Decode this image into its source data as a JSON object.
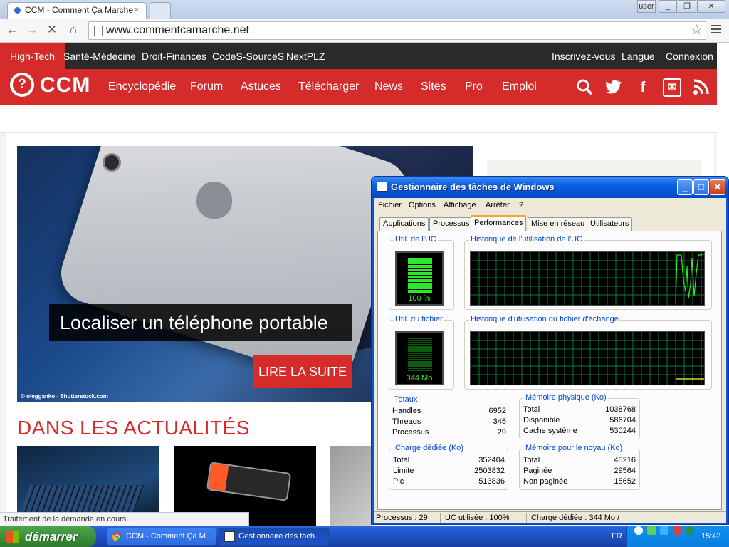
{
  "browser": {
    "tab_title": "CCM - Comment Ça Marche",
    "tab_close": "×",
    "url": "www.commentcamarche.net",
    "window_controls": [
      "user",
      "_",
      "❐",
      "✕"
    ]
  },
  "site": {
    "top_nav": [
      "High-Tech",
      "Santé-Médecine",
      "Droit-Finances",
      "CodeS-SourceS",
      "NextPLZ"
    ],
    "top_right": [
      "Inscrivez-vous",
      "Langue",
      "Connexion"
    ],
    "logo_mark": "?",
    "logo_text": "CCM",
    "main_nav": [
      "Encyclopédie",
      "Forum",
      "Astuces",
      "Télécharger",
      "News",
      "Sites",
      "Pro",
      "Emploi"
    ],
    "hero_title": "Localiser un téléphone portable",
    "hero_cta": "LIRE LA SUITE",
    "hero_credit": "© olegganko - Shutterstock.com",
    "section_title": "DANS LES ACTUALITÉS",
    "status_text": "Traitement de la demande en cours...",
    "colors": {
      "brand_red": "#d52b2b",
      "top_bar": "#2a2a2a"
    }
  },
  "taskmgr": {
    "title": "Gestionnaire des tâches de Windows",
    "menu": [
      "Fichier",
      "Options",
      "Affichage",
      "Arrêter",
      "?"
    ],
    "tabs": [
      "Applications",
      "Processus",
      "Performances",
      "Mise en réseau",
      "Utilisateurs"
    ],
    "active_tab": "Performances",
    "cpu_label": "Util. de l'UC",
    "cpu_value": "100 %",
    "cpu_history_label": "Historique de l'utilisation de l'UC",
    "pf_label": "Util. du fichier",
    "pf_value": "344 Mo",
    "pf_history_label": "Historique d'utilisation du fichier d'échange",
    "totals": {
      "title": "Totaux",
      "rows": [
        {
          "label": "Handles",
          "value": "6952"
        },
        {
          "label": "Threads",
          "value": "345"
        },
        {
          "label": "Processus",
          "value": "29"
        }
      ]
    },
    "physical": {
      "title": "Mémoire physique (Ko)",
      "rows": [
        {
          "label": "Total",
          "value": "1038768"
        },
        {
          "label": "Disponible",
          "value": "586704"
        },
        {
          "label": "Cache système",
          "value": "530244"
        }
      ]
    },
    "commit": {
      "title": "Charge dédiée (Ko)",
      "rows": [
        {
          "label": "Total",
          "value": "352404"
        },
        {
          "label": "Limite",
          "value": "2503832"
        },
        {
          "label": "Pic",
          "value": "513836"
        }
      ]
    },
    "kernel": {
      "title": "Mémoire pour le noyau (Ko)",
      "rows": [
        {
          "label": "Total",
          "value": "45216"
        },
        {
          "label": "Paginée",
          "value": "29564"
        },
        {
          "label": "Non paginée",
          "value": "15652"
        }
      ]
    },
    "status": [
      "Processus : 29",
      "UC utilisée : 100%",
      "Charge dédiée : 344 Mo /"
    ]
  },
  "taskbar": {
    "start_label": "démarrer",
    "tasks": [
      "CCM - Comment Ça M...",
      "Gestionnaire des tâch..."
    ],
    "lang": "FR",
    "clock": "15:42"
  }
}
